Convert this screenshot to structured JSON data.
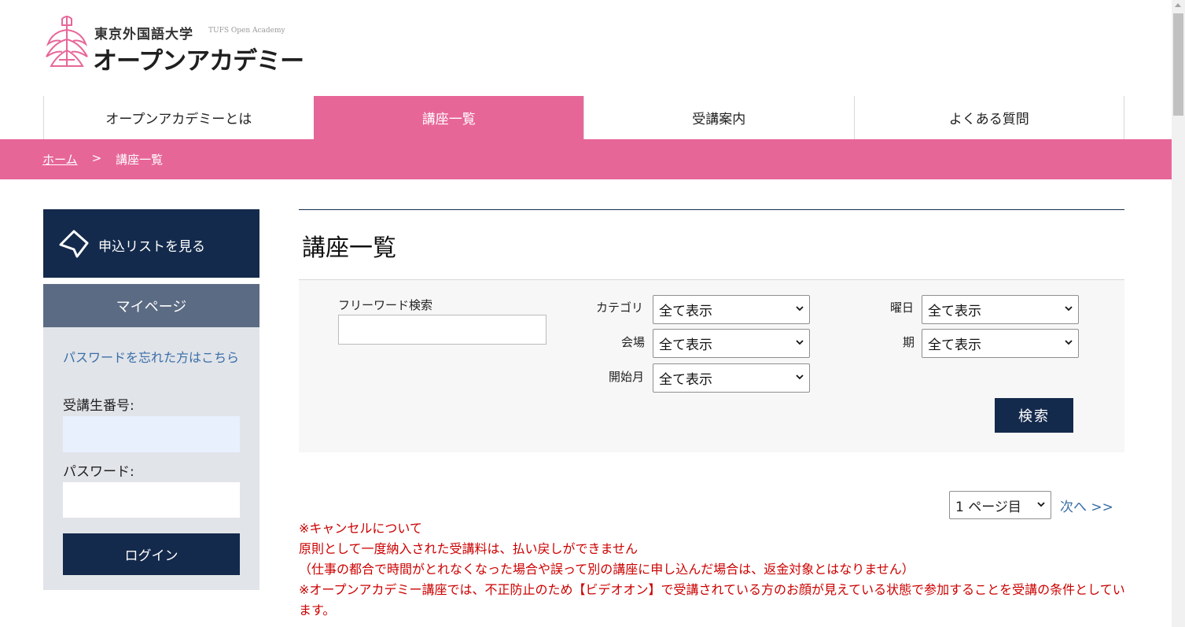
{
  "logo": {
    "university": "東京外国語大学",
    "english": "TUFS Open Academy",
    "academy": "オープンアカデミー",
    "brand_color": "#e76698"
  },
  "nav": {
    "items": [
      {
        "label": "オープンアカデミーとは",
        "active": false
      },
      {
        "label": "講座一覧",
        "active": true
      },
      {
        "label": "受講案内",
        "active": false
      },
      {
        "label": "よくある質問",
        "active": false
      }
    ]
  },
  "breadcrumb": {
    "home": "ホーム",
    "separator": ">",
    "current": "講座一覧"
  },
  "sidebar": {
    "apply_list": {
      "label": "申込リストを見る",
      "icon": "tag-icon"
    },
    "mypage": {
      "title": "マイページ"
    },
    "login": {
      "forgot_password": "パスワードを忘れた方はこちら",
      "student_id_label": "受講生番号:",
      "student_id_value": "",
      "password_label": "パスワード:",
      "password_value": "",
      "submit_label": "ログイン"
    }
  },
  "main": {
    "title": "講座一覧",
    "search": {
      "freeword_label": "フリーワード検索",
      "freeword_value": "",
      "category_label": "カテゴリ",
      "category_value": "全て表示",
      "venue_label": "会場",
      "venue_value": "全て表示",
      "start_month_label": "開始月",
      "start_month_value": "全て表示",
      "weekday_label": "曜日",
      "weekday_value": "全て表示",
      "term_label": "期",
      "term_value": "全て表示",
      "submit_label": "検索"
    },
    "pager": {
      "page_value": "1 ページ目",
      "next_label": "次へ >>"
    },
    "notice": {
      "line1": "※キャンセルについて",
      "line2": "原則として一度納入された受講料は、払い戻しができません",
      "line3": "（仕事の都合で時間がとれなくなった場合や誤って別の講座に申し込んだ場合は、返金対象とはなりません）",
      "line4": "※オープンアカデミー講座では、不正防止のため【ビデオオン】で受講されている方のお顔が見えている状態で参加することを受講の条件としています。"
    }
  },
  "colors": {
    "pink": "#e76698",
    "navy": "#142a4c",
    "slate": "#5b6b83",
    "link": "#3a6ea8",
    "notice": "#cc0000"
  }
}
